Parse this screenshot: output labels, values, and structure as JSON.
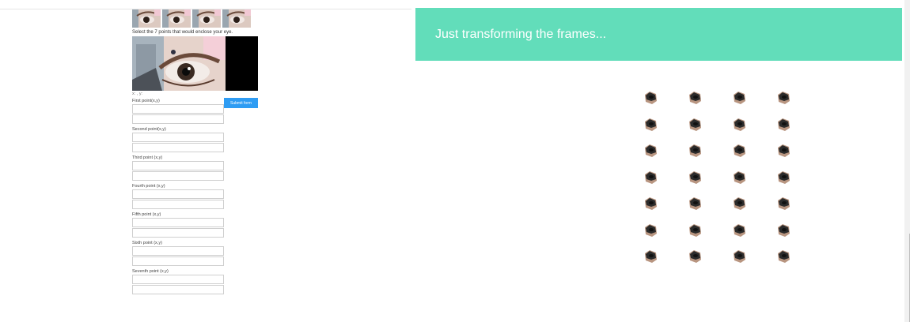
{
  "left_panel": {
    "thumbnail_count": 4,
    "instruction": "Select the 7 points that would enclose your eye.",
    "coord_readout": "x: , y:",
    "form": {
      "fields": [
        {
          "label": "First point(x,y)",
          "x_value": "",
          "y_value": ""
        },
        {
          "label": "Second point(x,y)",
          "x_value": "",
          "y_value": ""
        },
        {
          "label": "Third point (x,y)",
          "x_value": "",
          "y_value": ""
        },
        {
          "label": "Fourth point (x,y)",
          "x_value": "",
          "y_value": ""
        },
        {
          "label": "Fifth point (x,y)",
          "x_value": "",
          "y_value": ""
        },
        {
          "label": "Sixth point (x,y)",
          "x_value": "",
          "y_value": ""
        },
        {
          "label": "Seventh point (x,y)",
          "x_value": "",
          "y_value": ""
        }
      ],
      "submit_label": "Submit form"
    }
  },
  "right_panel": {
    "banner_text": "Just transforming the frames...",
    "banner_color": "#62ddba",
    "frame_grid": {
      "rows": 7,
      "cols": 4
    }
  },
  "colors": {
    "submit_button": "#2e9cf3"
  }
}
